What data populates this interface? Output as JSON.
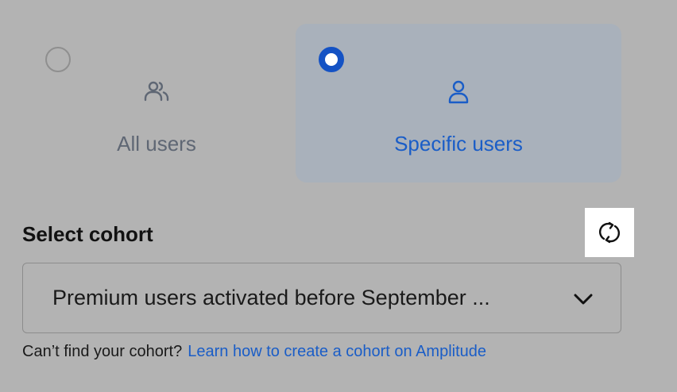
{
  "audience_options": [
    {
      "label": "All users",
      "icon": "users-icon",
      "selected": false
    },
    {
      "label": "Specific users",
      "icon": "user-icon",
      "selected": true
    }
  ],
  "cohort": {
    "section_label": "Select cohort",
    "refresh_icon": "refresh-icon",
    "selected_value": "Premium users activated before September ...",
    "dropdown_icon": "chevron-down-icon",
    "help_text": "Can’t find your cohort?",
    "help_link": "Learn how to create a cohort on Amplitude"
  },
  "colors": {
    "background": "#b3b3b3",
    "selected_card": "#a9b1bb",
    "accent": "#1a5dc7",
    "radio_checked": "#1452c4"
  }
}
